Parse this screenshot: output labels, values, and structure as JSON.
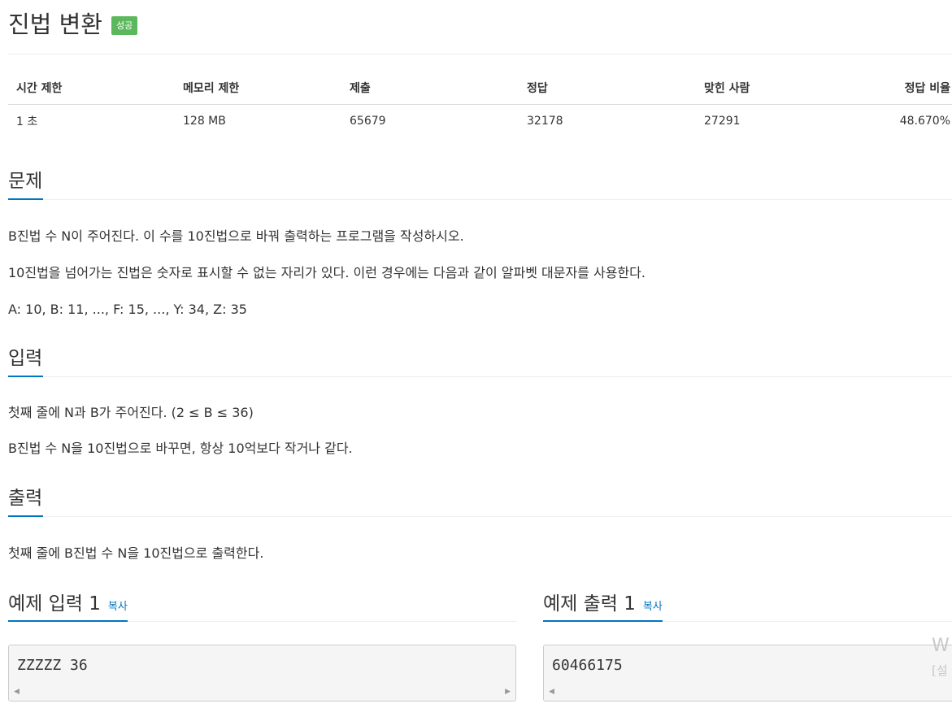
{
  "problem": {
    "title": "진법 변환",
    "status_badge": "성공"
  },
  "info_table": {
    "headers": [
      "시간 제한",
      "메모리 제한",
      "제출",
      "정답",
      "맞힌 사람",
      "정답 비율"
    ],
    "values": [
      "1 초",
      "128 MB",
      "65679",
      "32178",
      "27291",
      "48.670%"
    ]
  },
  "sections": {
    "description": {
      "heading": "문제",
      "paragraphs": [
        "B진법 수 N이 주어진다. 이 수를 10진법으로 바꿔 출력하는 프로그램을 작성하시오.",
        "10진법을 넘어가는 진법은 숫자로 표시할 수 없는 자리가 있다. 이런 경우에는 다음과 같이 알파벳 대문자를 사용한다.",
        "A: 10, B: 11, ..., F: 15, ..., Y: 34, Z: 35"
      ]
    },
    "input": {
      "heading": "입력",
      "paragraphs": [
        "첫째 줄에 N과 B가 주어진다. (2 ≤ B ≤ 36)",
        "B진법 수 N을 10진법으로 바꾸면, 항상 10억보다 작거나 같다."
      ]
    },
    "output": {
      "heading": "출력",
      "paragraphs": [
        "첫째 줄에 B진법 수 N을 10진법으로 출력한다."
      ]
    }
  },
  "samples": {
    "input": {
      "heading": "예제 입력 1",
      "copy_label": "복사",
      "content": "ZZZZZ 36"
    },
    "output": {
      "heading": "예제 출력 1",
      "copy_label": "복사",
      "content": "60466175"
    }
  },
  "overlay": {
    "watermark_line1": "W",
    "watermark_line2": "[설"
  },
  "colors": {
    "badge_success": "#5cb85c",
    "accent_blue": "#0076c0",
    "pre_background": "#f5f5f5"
  }
}
